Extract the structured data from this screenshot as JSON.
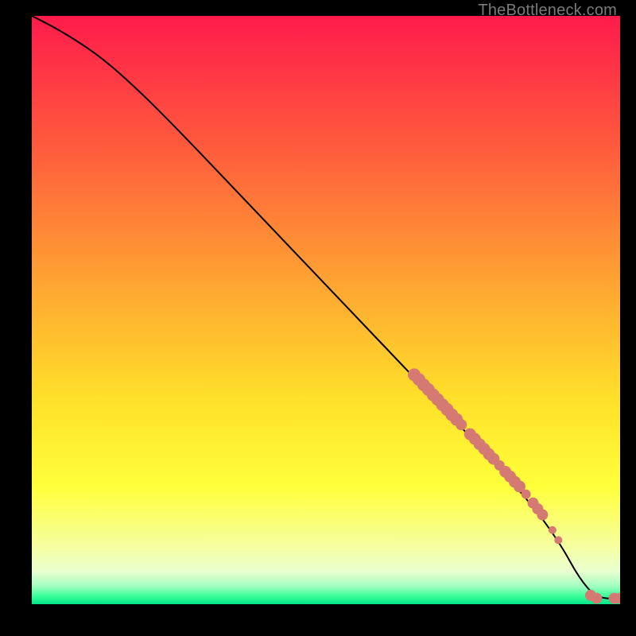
{
  "watermark": "TheBottleneck.com",
  "colors": {
    "bg": "#000000",
    "curve": "#000000",
    "dot_fill": "#d57a73",
    "dot_stroke": "#b85a53"
  },
  "chart_data": {
    "type": "line",
    "title": "",
    "xlabel": "",
    "ylabel": "",
    "xlim": [
      0,
      100
    ],
    "ylim": [
      0,
      100
    ],
    "grid": false,
    "legend": false,
    "gradient_stops": [
      {
        "offset": 0,
        "color": "#ff1b4b"
      },
      {
        "offset": 0.22,
        "color": "#ff5a3d"
      },
      {
        "offset": 0.45,
        "color": "#ffa332"
      },
      {
        "offset": 0.65,
        "color": "#ffe02a"
      },
      {
        "offset": 0.8,
        "color": "#ffff3a"
      },
      {
        "offset": 0.9,
        "color": "#f6ff9e"
      },
      {
        "offset": 0.945,
        "color": "#e9ffd0"
      },
      {
        "offset": 0.97,
        "color": "#9fffc0"
      },
      {
        "offset": 0.985,
        "color": "#3fff9c"
      },
      {
        "offset": 1.0,
        "color": "#00e687"
      }
    ],
    "curve": [
      {
        "x": 0,
        "y": 100
      },
      {
        "x": 3,
        "y": 98.5
      },
      {
        "x": 7,
        "y": 96.2
      },
      {
        "x": 12,
        "y": 92.8
      },
      {
        "x": 18,
        "y": 87.5
      },
      {
        "x": 25,
        "y": 80.5
      },
      {
        "x": 35,
        "y": 70.0
      },
      {
        "x": 45,
        "y": 59.5
      },
      {
        "x": 55,
        "y": 49.0
      },
      {
        "x": 65,
        "y": 38.5
      },
      {
        "x": 75,
        "y": 28.0
      },
      {
        "x": 85,
        "y": 17.0
      },
      {
        "x": 90,
        "y": 10.0
      },
      {
        "x": 93,
        "y": 4.5
      },
      {
        "x": 96,
        "y": 1.0
      },
      {
        "x": 100,
        "y": 1.0
      }
    ],
    "dots": [
      {
        "x": 65.0,
        "y": 39.0,
        "r": 1.6
      },
      {
        "x": 65.8,
        "y": 38.2,
        "r": 1.6
      },
      {
        "x": 66.6,
        "y": 37.3,
        "r": 1.6
      },
      {
        "x": 67.4,
        "y": 36.5,
        "r": 1.6
      },
      {
        "x": 68.2,
        "y": 35.6,
        "r": 1.6
      },
      {
        "x": 69.0,
        "y": 34.8,
        "r": 1.6
      },
      {
        "x": 69.8,
        "y": 33.9,
        "r": 1.6
      },
      {
        "x": 70.6,
        "y": 33.1,
        "r": 1.6
      },
      {
        "x": 71.4,
        "y": 32.2,
        "r": 1.6
      },
      {
        "x": 72.2,
        "y": 31.4,
        "r": 1.6
      },
      {
        "x": 73.0,
        "y": 30.5,
        "r": 1.4
      },
      {
        "x": 74.5,
        "y": 28.9,
        "r": 1.5
      },
      {
        "x": 75.3,
        "y": 28.1,
        "r": 1.5
      },
      {
        "x": 76.1,
        "y": 27.2,
        "r": 1.5
      },
      {
        "x": 76.9,
        "y": 26.4,
        "r": 1.5
      },
      {
        "x": 77.7,
        "y": 25.5,
        "r": 1.5
      },
      {
        "x": 78.5,
        "y": 24.7,
        "r": 1.5
      },
      {
        "x": 79.5,
        "y": 23.6,
        "r": 1.3
      },
      {
        "x": 80.5,
        "y": 22.5,
        "r": 1.5
      },
      {
        "x": 81.3,
        "y": 21.7,
        "r": 1.5
      },
      {
        "x": 82.1,
        "y": 20.8,
        "r": 1.5
      },
      {
        "x": 82.9,
        "y": 20.0,
        "r": 1.5
      },
      {
        "x": 84.0,
        "y": 18.7,
        "r": 1.2
      },
      {
        "x": 85.2,
        "y": 17.2,
        "r": 1.4
      },
      {
        "x": 86.0,
        "y": 16.2,
        "r": 1.4
      },
      {
        "x": 86.8,
        "y": 15.2,
        "r": 1.4
      },
      {
        "x": 88.5,
        "y": 12.6,
        "r": 1.0
      },
      {
        "x": 89.5,
        "y": 10.9,
        "r": 1.0
      },
      {
        "x": 95.0,
        "y": 1.5,
        "r": 1.4
      },
      {
        "x": 96.0,
        "y": 1.0,
        "r": 1.4
      },
      {
        "x": 99.0,
        "y": 1.0,
        "r": 1.4
      },
      {
        "x": 100.0,
        "y": 1.0,
        "r": 1.4
      }
    ]
  }
}
